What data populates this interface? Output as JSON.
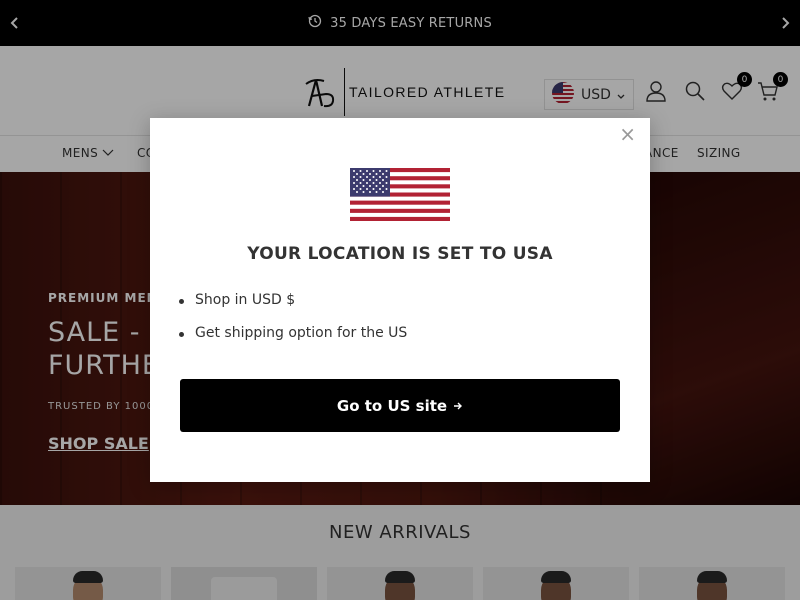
{
  "announcement": {
    "text": "35 DAYS EASY RETURNS",
    "icon": "history-icon",
    "prev_icon": "chevron-left-icon",
    "next_icon": "chevron-right-icon"
  },
  "header": {
    "logo_text": "TAILORED ATHLETE",
    "currency": {
      "code": "USD",
      "flag": "us-flag-icon"
    },
    "account_icon": "user-icon",
    "search_icon": "search-icon",
    "wishlist": {
      "icon": "heart-icon",
      "count": "0"
    },
    "cart": {
      "icon": "cart-icon",
      "count": "0"
    }
  },
  "nav": {
    "items": [
      {
        "label": "MENS"
      },
      {
        "label": "CO"
      },
      {
        "label": "ANCE"
      },
      {
        "label": "SIZING"
      }
    ]
  },
  "hero": {
    "kicker": "PREMIUM MEN",
    "headline": "SALE - U\nFURTHE",
    "trust": "TRUSTED BY 1000",
    "cta": "SHOP SALE"
  },
  "arrivals": {
    "title": "NEW ARRIVALS"
  },
  "modal": {
    "heading": "YOUR LOCATION IS SET TO USA",
    "bullets": [
      "Shop in USD $",
      "Get shipping option for the US"
    ],
    "button_label": "Go to US site",
    "button_icon": "arrow-right-icon",
    "close_glyph": "×"
  },
  "colors": {
    "announce_bg": "#000000",
    "button_bg": "#000000",
    "text": "#333333"
  }
}
